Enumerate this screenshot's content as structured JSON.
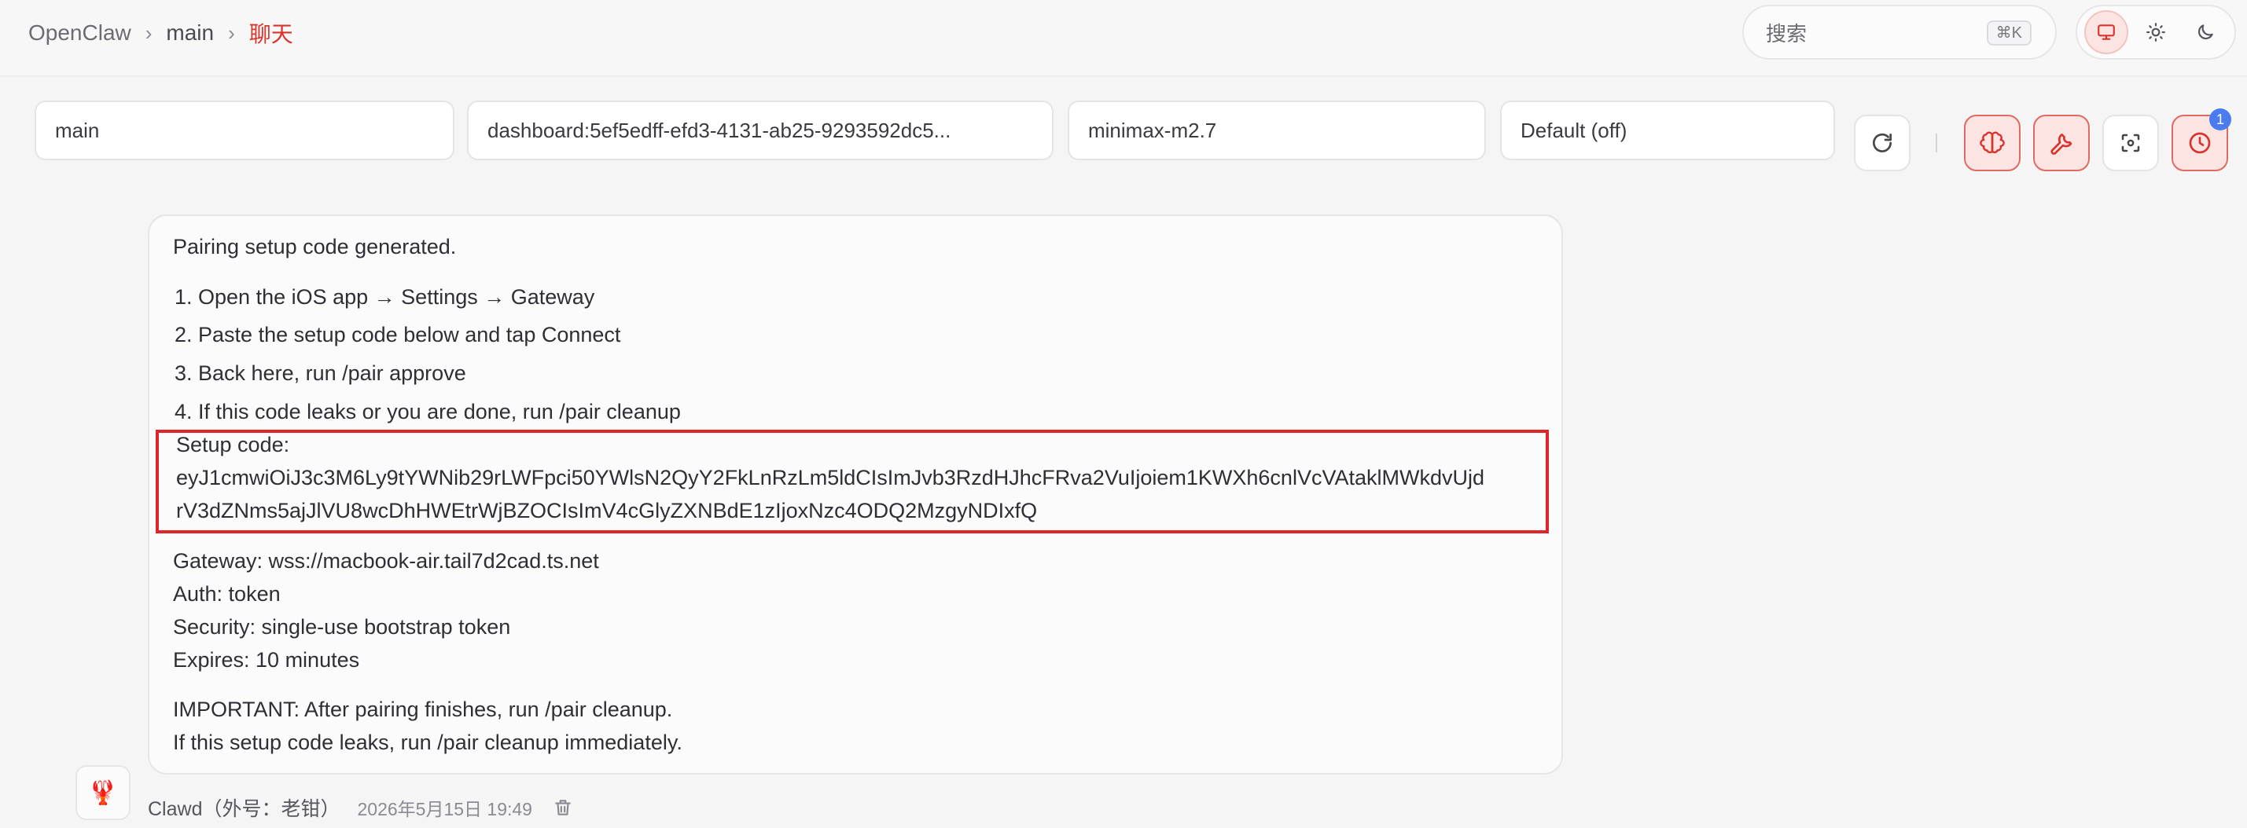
{
  "breadcrumb": {
    "root": "OpenClaw",
    "sep1": "›",
    "main": "main",
    "sep2": "›",
    "current": "聊天"
  },
  "search": {
    "label": "搜索",
    "shortcut": "⌘K"
  },
  "theme": {
    "options": [
      "monitor-icon",
      "sun-icon",
      "moon-icon"
    ],
    "active": "monitor-icon"
  },
  "selectors": {
    "agent": "main",
    "session": "dashboard:5ef5edff-efd3-4131-ab25-9293592dc5...",
    "model": "minimax-m2.7",
    "thinking": "Default (off)"
  },
  "toolbar": {
    "icons": [
      "refresh-icon",
      "brain-icon",
      "wrench-icon",
      "focus-icon",
      "clock-icon"
    ],
    "clock_badge": "1",
    "accent": "#d9342b"
  },
  "message": {
    "intro": "Pairing setup code generated.",
    "steps": [
      "1. Open the iOS app → Settings → Gateway",
      "2. Paste the setup code below and tap Connect",
      "3. Back here, run /pair approve",
      "4. If this code leaks or you are done, run /pair cleanup"
    ],
    "setup_label": "Setup code:",
    "code_line1": "eyJ1cmwiOiJ3c3M6Ly9tYWNib29rLWFpci50YWlsN2QyY2FkLnRzLm5ldCIsImJvb3RzdHJhcFRva2VuIjoiem1KWXh6cnlVcVAtaklMWkdvUjd",
    "code_line2": "rV3dZNms5ajJlVU8wcDhHWEtrWjBZOCIsImV4cGlyZXNBdE1zIjoxNzc4ODQ2MzgyNDIxfQ",
    "gateway": "Gateway: wss://macbook-air.tail7d2cad.ts.net",
    "auth": "Auth: token",
    "security": "Security: single-use bootstrap token",
    "expires": "Expires: 10 minutes",
    "important1": "IMPORTANT: After pairing finishes, run /pair cleanup.",
    "important2": "If this setup code leaks, run /pair cleanup immediately.",
    "highlight_color": "#e0242b"
  },
  "meta": {
    "avatar": "🦞",
    "sender": "Clawd（外号：老钳）",
    "timestamp": "2026年5月15日 19:49"
  }
}
